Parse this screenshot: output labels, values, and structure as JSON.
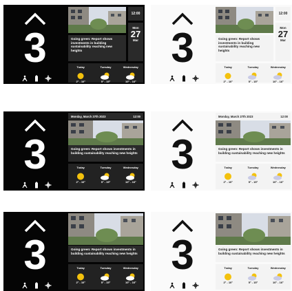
{
  "floor_number": "3",
  "time": "12:00",
  "date_box": {
    "weekday": "Mon",
    "day": "27",
    "month": "Mar"
  },
  "date_bar": {
    "date": "Monday, March 27th 2023",
    "time": "12:00"
  },
  "news_headline": "Going green: Report shows investments in building sustainability reaching new heights",
  "forecast": [
    {
      "day": "Today",
      "icon": "sun-icon",
      "temp": "2° - 10°"
    },
    {
      "day": "Tuesday",
      "icon": "partly-cloudy-icon",
      "temp": "5° - 15°"
    },
    {
      "day": "Wednesday",
      "icon": "partly-cloudy-icon",
      "temp": "10° - 16°"
    }
  ],
  "colors": {
    "dark_bg": "#050505",
    "light_bg": "#fafafa",
    "sun": "#f3c10d",
    "tile_dark": "#2a2a2a",
    "tile_light": "#f3f3f3"
  },
  "status_icons": [
    "accessibility-icon",
    "battery-icon",
    "move-icon"
  ]
}
